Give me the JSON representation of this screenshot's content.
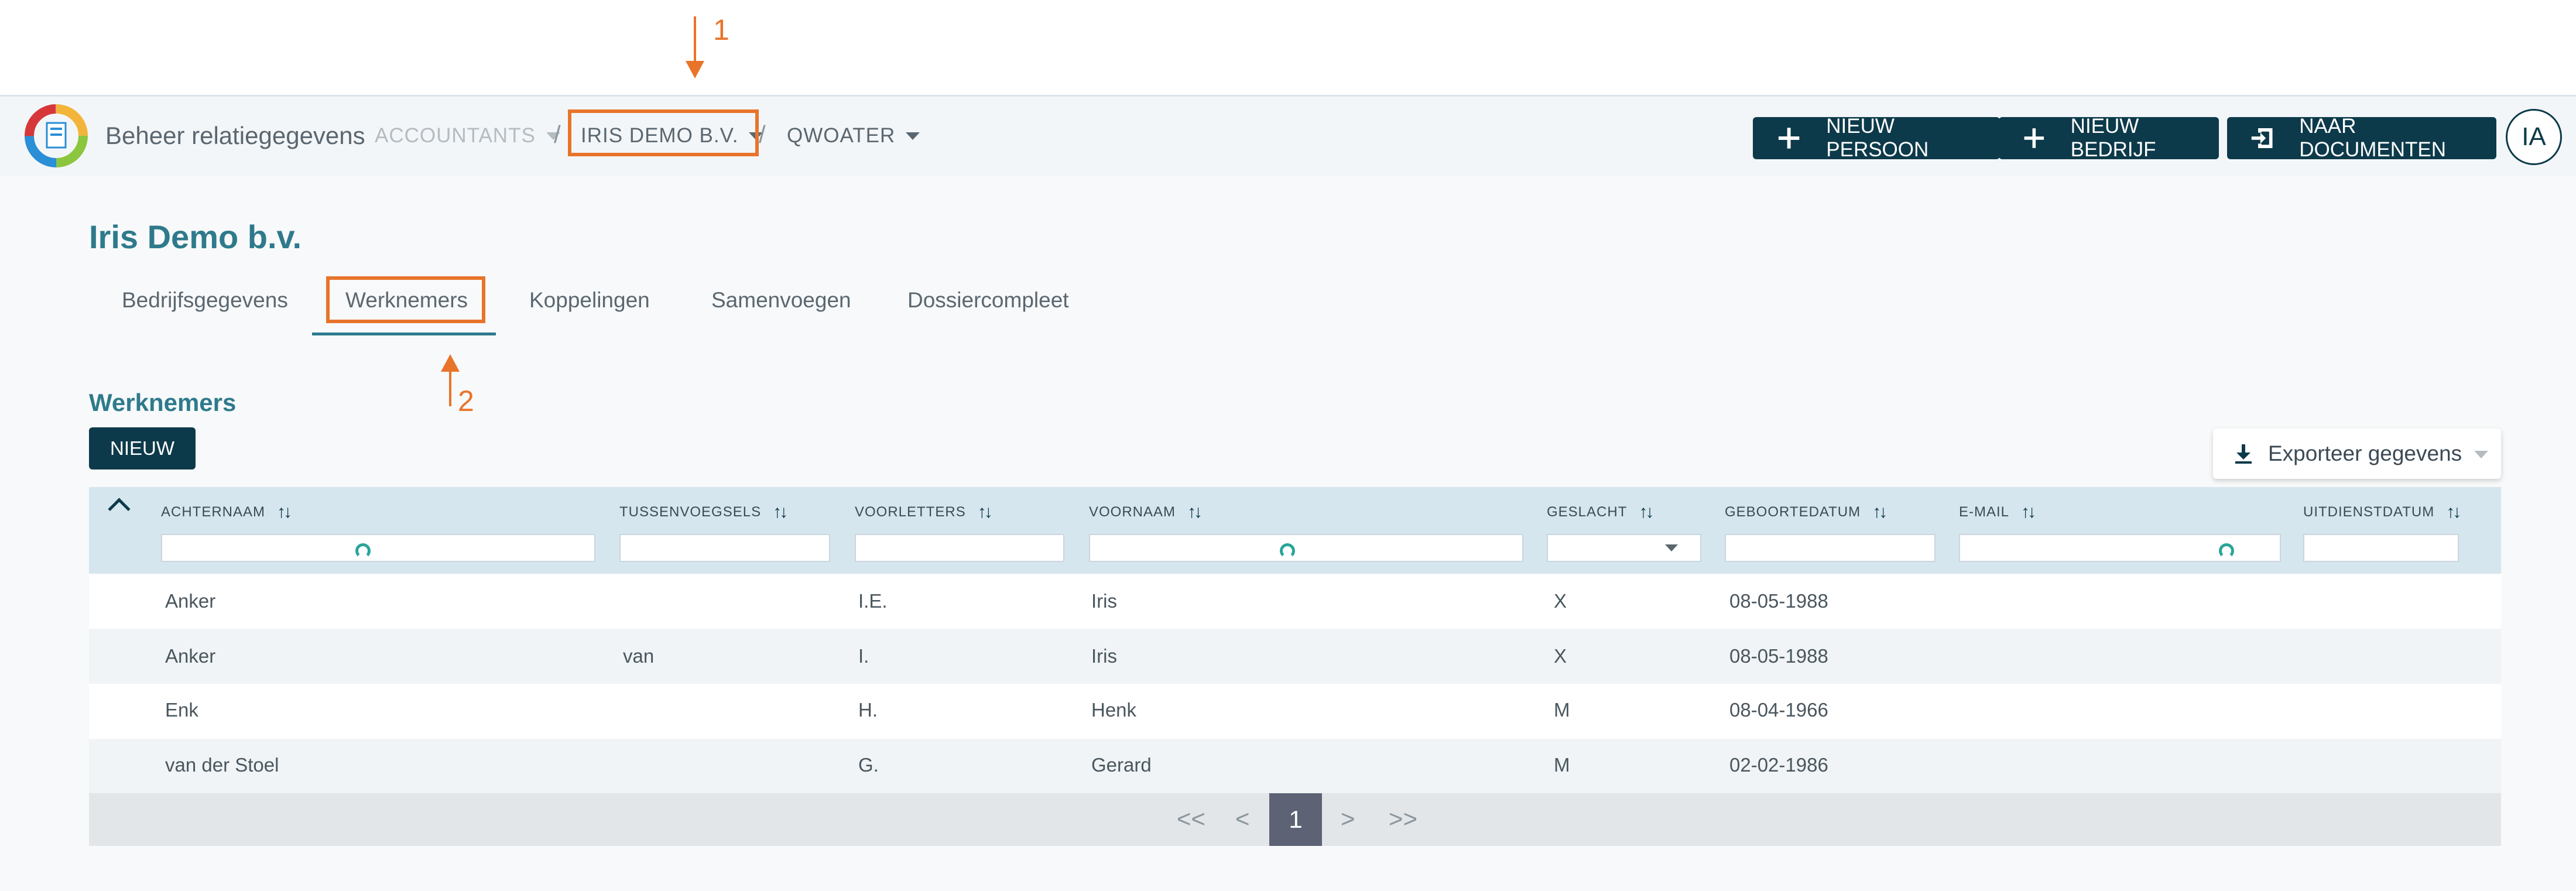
{
  "annotations": [
    "1",
    "2"
  ],
  "header": {
    "app_title": "Beheer relatiegegevens",
    "breadcrumbs": [
      {
        "label": "ACCOUNTANTS",
        "state": "muted"
      },
      {
        "label": "IRIS DEMO B.V.",
        "state": "active"
      },
      {
        "label": "QWOATER",
        "state": "active"
      }
    ],
    "separator": "/",
    "buttons": {
      "new_person": "NIEUW PERSOON",
      "new_company": "NIEUW BEDRIJF",
      "to_documents": "NAAR DOCUMENTEN"
    },
    "avatar_initials": "IA"
  },
  "page": {
    "title": "Iris Demo b.v.",
    "tabs": [
      "Bedrijfsgegevens",
      "Werknemers",
      "Koppelingen",
      "Samenvoegen",
      "Dossiercompleet"
    ],
    "active_tab": "Werknemers"
  },
  "section": {
    "title": "Werknemers",
    "new_button": "NIEUW",
    "export_button": "Exporteer gegevens"
  },
  "table": {
    "columns": [
      "ACHTERNAAM",
      "TUSSENVOEGSELS",
      "VOORLETTERS",
      "VOORNAAM",
      "GESLACHT",
      "GEBOORTEDATUM",
      "E-MAIL",
      "UITDIENSTDATUM"
    ],
    "rows": [
      [
        "Anker",
        "",
        "I.E.",
        "Iris",
        "X",
        "08-05-1988",
        "",
        ""
      ],
      [
        "Anker",
        "van",
        "I.",
        "Iris",
        "X",
        "08-05-1988",
        "",
        ""
      ],
      [
        "Enk",
        "",
        "H.",
        "Henk",
        "M",
        "08-04-1966",
        "",
        ""
      ],
      [
        "van der Stoel",
        "",
        "G.",
        "Gerard",
        "M",
        "02-02-1986",
        "",
        ""
      ]
    ]
  },
  "pagination": {
    "first": "<<",
    "prev": "<",
    "current": "1",
    "next": ">",
    "last": ">>"
  },
  "colors": {
    "accent_dark": "#0d3a4a",
    "accent_teal": "#2e7a8c",
    "annotation": "#e8742a",
    "table_header": "#d6e6ee"
  }
}
